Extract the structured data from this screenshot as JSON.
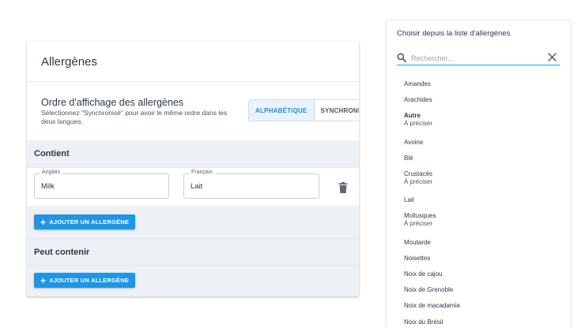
{
  "card": {
    "title": "Allergènes",
    "order": {
      "title": "Ordre d'affichage des allergènes",
      "help": "Sélectionnez \"Synchronisé\" pour avoir le même ordre dans les deux langues.",
      "options": [
        "ALPHABÉTIQUE",
        "SYNCHRONISÉ"
      ],
      "selected": "ALPHABÉTIQUE"
    },
    "contains": {
      "label": "Contient",
      "english_label": "Anglais",
      "english_value": "Milk",
      "french_label": "Français",
      "french_value": "Lait",
      "delete_icon": "trash-icon",
      "add_button": "AJOUTER UN ALLERGÈNE"
    },
    "may_contain": {
      "label": "Peut contenir",
      "add_button": "AJOUTER UN ALLERGÈNE"
    }
  },
  "panel": {
    "title": "Choisir depuis la liste d'allergènes",
    "search_placeholder": "Rechercher...",
    "items": [
      {
        "name": "Amandes",
        "sub": ""
      },
      {
        "name": "Arachides",
        "sub": ""
      },
      {
        "name": "Autre",
        "sub": "À préciser",
        "bold": true
      },
      {
        "name": "Avoine",
        "sub": ""
      },
      {
        "name": "Blé",
        "sub": ""
      },
      {
        "name": "Crustacés",
        "sub": "À préciser"
      },
      {
        "name": "Lait",
        "sub": ""
      },
      {
        "name": "Mollusques",
        "sub": "À préciser"
      },
      {
        "name": "Moutarde",
        "sub": ""
      },
      {
        "name": "Noisettes",
        "sub": ""
      },
      {
        "name": "Noix de cajou",
        "sub": ""
      },
      {
        "name": "Noix de Grenoble",
        "sub": ""
      },
      {
        "name": "Noix de macadamia",
        "sub": ""
      },
      {
        "name": "Noix du Brésil",
        "sub": ""
      }
    ]
  },
  "colors": {
    "accent": "#1e96e8",
    "section_bg": "#edf0f4",
    "text": "#2b3a4a"
  }
}
